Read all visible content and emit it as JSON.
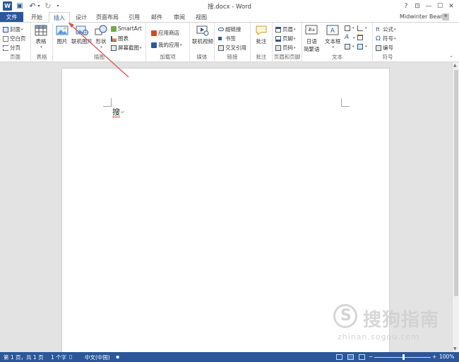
{
  "quick_access": {
    "logo_letter": "W",
    "save_glyph": "▣",
    "undo_glyph": "↶",
    "dropdown_glyph": "▾",
    "redo_glyph": "↻",
    "customize_glyph": "▾"
  },
  "window": {
    "title": "搜.docx - Word",
    "help": "?",
    "ribbon_display": "⊡",
    "minimize": "—",
    "maximize": "☐",
    "close": "✕"
  },
  "tabs": {
    "file": "文件",
    "home": "开始",
    "insert": "插入",
    "design": "设计",
    "layout": "页面布局",
    "references": "引用",
    "mailings": "邮件",
    "review": "审阅",
    "view": "视图"
  },
  "account": {
    "user": "Midwinter Bear"
  },
  "ribbon": {
    "pages": {
      "label": "页面",
      "cover": "封面",
      "blank": "空白页",
      "break": "分页"
    },
    "tables": {
      "label": "表格",
      "table": "表格"
    },
    "illustrations": {
      "label": "插图",
      "pictures": "图片",
      "online_pictures": "联机图片",
      "shapes": "形状",
      "smartart": "SmartArt",
      "chart": "图表",
      "screenshot": "屏幕截图"
    },
    "addins": {
      "label": "加载项",
      "store": "应用商店",
      "my_apps": "我的应用"
    },
    "media": {
      "label": "媒体",
      "online_video": "联机视频"
    },
    "links": {
      "label": "链接",
      "hyperlink": "超链接",
      "bookmark": "书签",
      "crossref": "交叉引用"
    },
    "comments": {
      "label": "批注",
      "comment": "批注"
    },
    "header_footer": {
      "label": "页眉和页脚",
      "header": "页眉",
      "footer": "页脚",
      "page_number": "页码"
    },
    "text": {
      "label": "文本",
      "quick_parts_1": "日语",
      "quick_parts_2": "简繁语",
      "textbox": "文本框"
    },
    "symbols": {
      "label": "符号",
      "equation": "公式",
      "symbol": "符号",
      "numbering": "编号"
    },
    "collapse": "⌃"
  },
  "document": {
    "text": "搜",
    "paragraph_mark": "↵"
  },
  "watermark": {
    "cn": "搜狗指南",
    "url": "zhinan.sogou.com"
  },
  "status": {
    "page": "第 1 页，共 1 页",
    "words": "1 个字",
    "language": "中文(中国)",
    "zoom_minus": "−",
    "zoom_plus": "+",
    "zoom": "100%"
  },
  "colors": {
    "brand_blue": "#2b579a",
    "annotation_red": "#d9534f"
  }
}
